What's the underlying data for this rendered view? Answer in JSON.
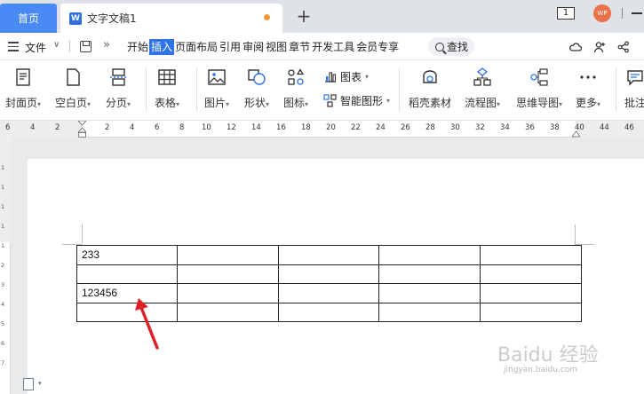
{
  "titlebar": {
    "home_tab": "首页",
    "doc_tab": "文字文稿1",
    "doc_icon": "W",
    "new_tab": "+",
    "window_count": "1",
    "avatar_text": "WP"
  },
  "menubar": {
    "file": "文件",
    "items": [
      "开始",
      "插入",
      "页面布局",
      "引用",
      "审阅",
      "视图",
      "章节",
      "开发工具",
      "会员专享"
    ],
    "active_index": 1,
    "search": "查找"
  },
  "ribbon": {
    "cover": "封面页",
    "blank": "空白页",
    "page_break": "分页",
    "table": "表格",
    "picture": "图片",
    "shape": "形状",
    "icons": "图标",
    "chart": "图表",
    "smart_graphic": "智能图形",
    "daoke": "稻壳素材",
    "flowchart": "流程图",
    "mindmap": "思维导图",
    "more": "更多",
    "annotate": "批注"
  },
  "ruler": {
    "numbers": [
      "6",
      "4",
      "2",
      "2",
      "4",
      "6",
      "8",
      "10",
      "12",
      "14",
      "16",
      "18",
      "20",
      "22",
      "24",
      "26",
      "28",
      "30",
      "32",
      "34",
      "36",
      "38",
      "40",
      "44",
      "46"
    ]
  },
  "vruler": {
    "numbers": [
      "1",
      "1",
      "1",
      "1",
      "1",
      "2",
      "3",
      "4",
      "5",
      "6",
      "7"
    ]
  },
  "table": {
    "rows": [
      [
        "233",
        "",
        "",
        "",
        ""
      ],
      [
        "",
        "",
        "",
        "",
        ""
      ],
      [
        "123456",
        "",
        "",
        "",
        ""
      ],
      [
        "",
        "",
        "",
        "",
        ""
      ]
    ]
  },
  "watermark": {
    "brand": "Baidu 经验",
    "url": "jingyan.baidu.com"
  },
  "colors": {
    "accent": "#2f73e8",
    "home_tab": "#4a8af4",
    "arrow": "#e0202a"
  }
}
